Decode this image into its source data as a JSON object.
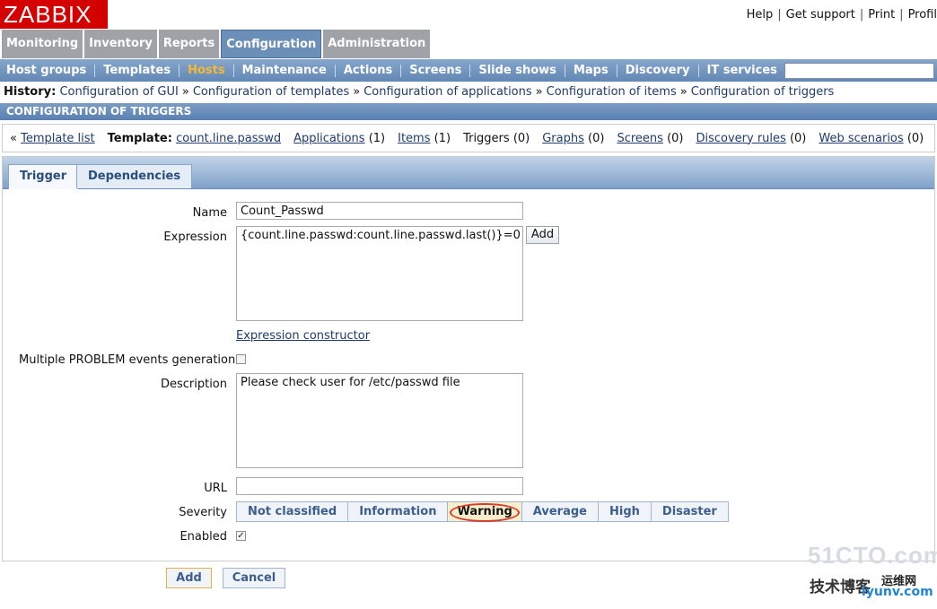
{
  "header": {
    "logo": "ZABBIX",
    "links": [
      "Help",
      "Get support",
      "Print",
      "Profil"
    ]
  },
  "main_tabs": [
    "Monitoring",
    "Inventory",
    "Reports",
    "Configuration",
    "Administration"
  ],
  "main_tabs_active": "Configuration",
  "sub_menu": [
    "Host groups",
    "Templates",
    "Hosts",
    "Maintenance",
    "Actions",
    "Screens",
    "Slide shows",
    "Maps",
    "Discovery",
    "IT services"
  ],
  "sub_menu_active": "Hosts",
  "history": {
    "label": "History:",
    "items": [
      "Configuration of GUI",
      "Configuration of templates",
      "Configuration of applications",
      "Configuration of items",
      "Configuration of triggers"
    ],
    "separator": "»"
  },
  "section_title": "CONFIGURATION OF TRIGGERS",
  "template_nav": {
    "back_prefix": "«",
    "template_list": "Template list",
    "template_label": "Template:",
    "template_name": "count.line.passwd",
    "applications": "Applications",
    "applications_count": "(1)",
    "items": "Items",
    "items_count": "(1)",
    "triggers": "Triggers",
    "triggers_count": "(0)",
    "graphs": "Graphs",
    "graphs_count": "(0)",
    "screens": "Screens",
    "screens_count": "(0)",
    "discovery_rules": "Discovery rules",
    "discovery_rules_count": "(0)",
    "web_scenarios": "Web scenarios",
    "web_scenarios_count": "(0)"
  },
  "form_tabs": [
    "Trigger",
    "Dependencies"
  ],
  "form": {
    "name_label": "Name",
    "name_value": "Count_Passwd",
    "expression_label": "Expression",
    "expression_value": "{count.line.passwd:count.line.passwd.last()}=0",
    "expression_add": "Add",
    "expression_constructor": "Expression constructor",
    "multiple_label": "Multiple PROBLEM events generation",
    "multiple_checked": false,
    "description_label": "Description",
    "description_value": "Please check user for  /etc/passwd file",
    "url_label": "URL",
    "url_value": "",
    "severity_label": "Severity",
    "severity_options": [
      "Not classified",
      "Information",
      "Warning",
      "Average",
      "High",
      "Disaster"
    ],
    "severity_selected": "Warning",
    "enabled_label": "Enabled",
    "enabled_checked": true
  },
  "footer_buttons": {
    "add": "Add",
    "cancel": "Cancel"
  },
  "watermark": {
    "line1": "51CTO.com",
    "line2": "技术博客",
    "line3": "iyunv.com",
    "line4": "运维网"
  },
  "colors": {
    "logo_red": "#d40000",
    "nav_blue": "#6288b4",
    "active_sub": "#f6b82e",
    "severity_highlight": "#d83a2c"
  }
}
